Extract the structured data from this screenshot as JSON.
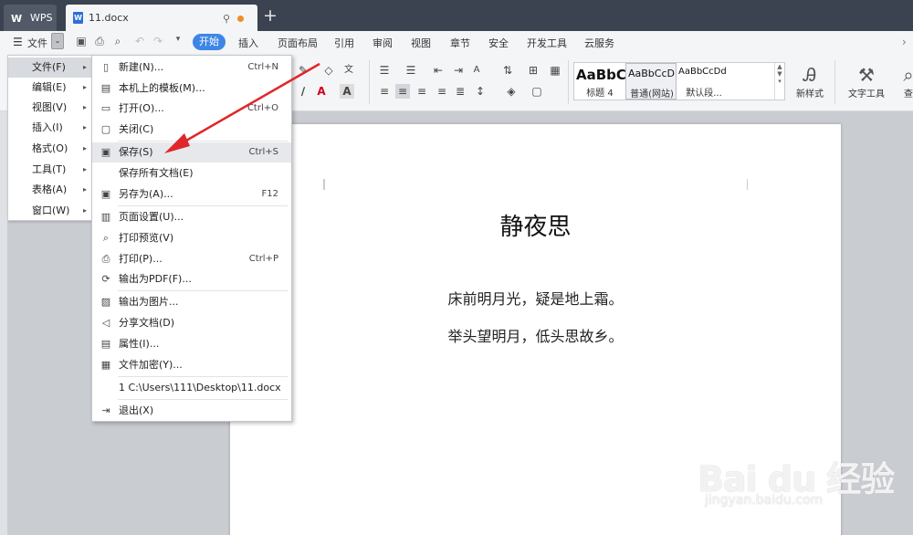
{
  "titlebar": {
    "app_tab": "WPS",
    "doc_tab": "11.docx",
    "new_tab": "+"
  },
  "menubar": {
    "file": "文件",
    "tabs": [
      "开始",
      "插入",
      "页面布局",
      "引用",
      "审阅",
      "视图",
      "章节",
      "安全",
      "开发工具",
      "云服务"
    ]
  },
  "ribbon": {
    "styles": [
      {
        "sample": "AaBbC",
        "name": "标题 4"
      },
      {
        "sample": "AaBbCcD",
        "name": "普通(网站)"
      },
      {
        "sample": "AaBbCcDd",
        "name": "默认段..."
      }
    ],
    "new_style": "新样式",
    "text_tools": "文字工具",
    "cut_off": "查"
  },
  "submenu": {
    "items": [
      "文件(F)",
      "编辑(E)",
      "视图(V)",
      "插入(I)",
      "格式(O)",
      "工具(T)",
      "表格(A)",
      "窗口(W)"
    ]
  },
  "dropdown": {
    "items": [
      {
        "label": "新建(N)...",
        "key": "Ctrl+N",
        "icon": "new-doc-icon"
      },
      {
        "label": "本机上的模板(M)...",
        "key": "",
        "icon": "template-icon"
      },
      {
        "label": "打开(O)...",
        "key": "Ctrl+O",
        "icon": "open-folder-icon"
      },
      {
        "label": "关闭(C)",
        "key": "",
        "icon": "close-doc-icon"
      },
      {
        "label": "保存(S)",
        "key": "Ctrl+S",
        "icon": "save-icon"
      },
      {
        "label": "保存所有文档(E)",
        "key": "",
        "icon": ""
      },
      {
        "label": "另存为(A)...",
        "key": "F12",
        "icon": "save-as-icon"
      },
      {
        "label": "页面设置(U)...",
        "key": "",
        "icon": "page-setup-icon"
      },
      {
        "label": "打印预览(V)",
        "key": "",
        "icon": "print-preview-icon"
      },
      {
        "label": "打印(P)...",
        "key": "Ctrl+P",
        "icon": "print-icon"
      },
      {
        "label": "输出为PDF(F)...",
        "key": "",
        "icon": "pdf-icon"
      },
      {
        "label": "输出为图片...",
        "key": "",
        "icon": "image-icon"
      },
      {
        "label": "分享文档(D)",
        "key": "",
        "icon": "share-icon"
      },
      {
        "label": "属性(I)...",
        "key": "",
        "icon": "properties-icon"
      },
      {
        "label": "文件加密(Y)...",
        "key": "",
        "icon": "encrypt-icon"
      },
      {
        "label": "1 C:\\Users\\111\\Desktop\\11.docx",
        "key": "",
        "icon": ""
      },
      {
        "label": "退出(X)",
        "key": "",
        "icon": "exit-icon"
      }
    ]
  },
  "document": {
    "title": "静夜思",
    "lines": [
      "床前明月光，疑是地上霜。",
      "举头望明月，低头思故乡。"
    ]
  },
  "watermark": {
    "logo": "Bai du 经验",
    "url": "jingyan.baidu.com"
  },
  "colors": {
    "titlebar": "#3b4350",
    "accent": "#3d86e8",
    "arrow": "#e0262b"
  }
}
